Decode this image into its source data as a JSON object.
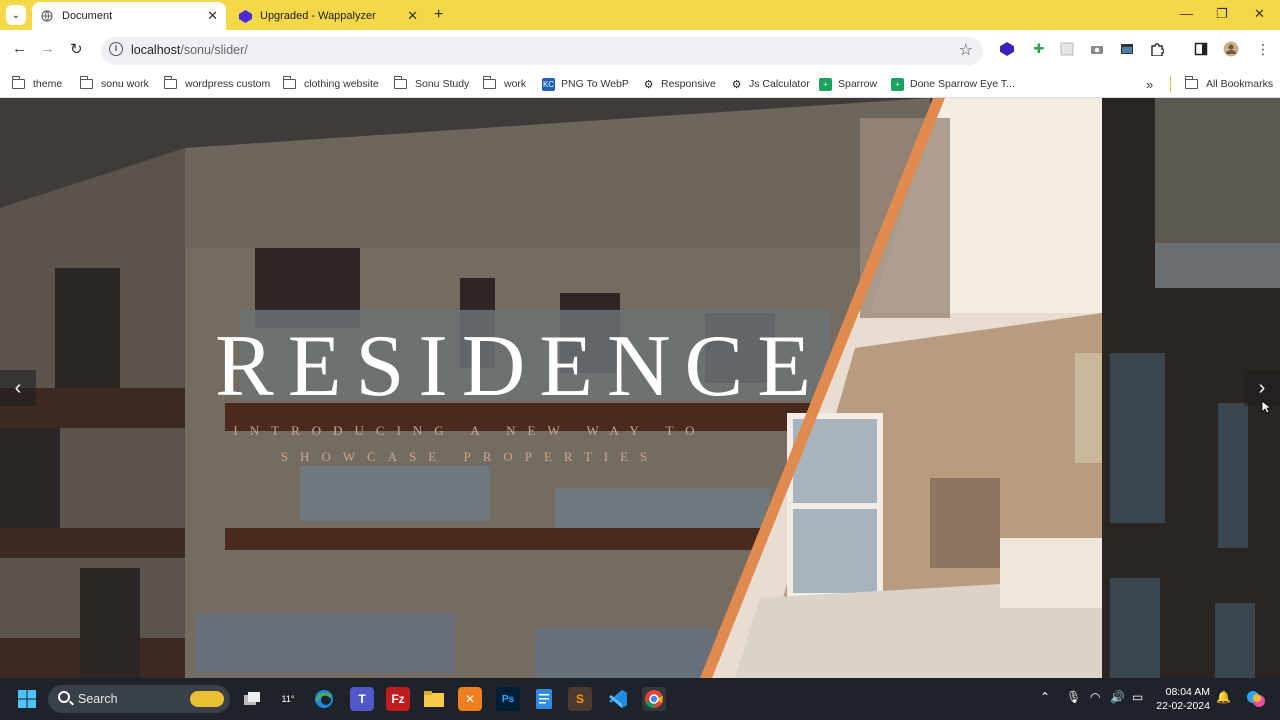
{
  "browser": {
    "tabs": [
      {
        "label": "Document",
        "active": true
      },
      {
        "label": "Upgraded - Wappalyzer",
        "active": false
      }
    ],
    "url": {
      "host": "localhost",
      "path": "/sonu/slider/"
    },
    "bookmarks": [
      {
        "label": "theme",
        "type": "folder"
      },
      {
        "label": "sonu work",
        "type": "folder"
      },
      {
        "label": "wordpress custom",
        "type": "folder"
      },
      {
        "label": "clothing website",
        "type": "folder"
      },
      {
        "label": "Sonu Study",
        "type": "folder"
      },
      {
        "label": "work",
        "type": "folder"
      },
      {
        "label": "PNG To WebP",
        "type": "link"
      },
      {
        "label": "Responsive",
        "type": "link"
      },
      {
        "label": "Js Calculator",
        "type": "link"
      },
      {
        "label": "Sparrow",
        "type": "link"
      },
      {
        "label": "Done Sparrow Eye T...",
        "type": "link"
      }
    ],
    "all_bookmarks": "All Bookmarks",
    "overflow": "»"
  },
  "slider": {
    "title": "RESIDENCE",
    "subtitle_line1": "INTRODUCING A NEW WAY TO",
    "subtitle_line2": "SHOWCASE PROPERTIES",
    "prev": "‹",
    "next": "›"
  },
  "taskbar": {
    "search": "Search",
    "weather": "11°",
    "time": "08:04 AM",
    "date": "22-02-2024"
  },
  "colors": {
    "tab_bar": "#f5d84a",
    "subtitle": "#c9a98d",
    "divider": "#e08a4f"
  }
}
